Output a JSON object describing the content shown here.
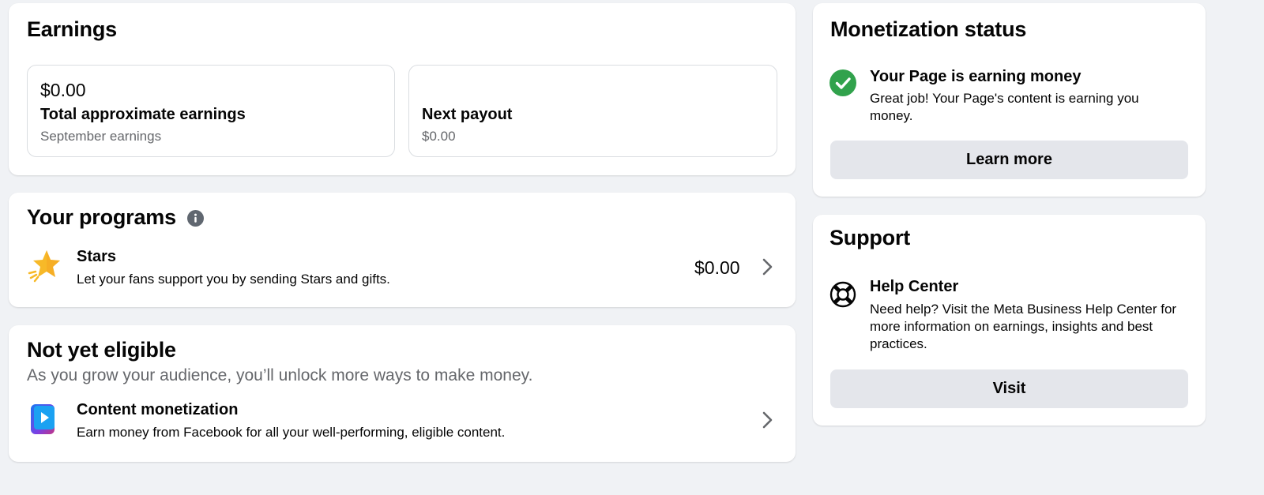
{
  "earnings": {
    "title": "Earnings",
    "total": {
      "amount": "$0.00",
      "label": "Total approximate earnings",
      "sub": "September earnings"
    },
    "payout": {
      "label": "Next payout",
      "sub": "$0.00"
    }
  },
  "programs": {
    "title": "Your programs",
    "items": [
      {
        "title": "Stars",
        "desc": "Let your fans support you by sending Stars and gifts.",
        "amount": "$0.00"
      }
    ]
  },
  "not_eligible": {
    "title": "Not yet eligible",
    "subtitle": "As you grow your audience, you’ll unlock more ways to make money.",
    "items": [
      {
        "title": "Content monetization",
        "desc": "Earn money from Facebook for all your well-performing, eligible content."
      }
    ]
  },
  "monetization": {
    "title": "Monetization status",
    "status_title": "Your Page is earning money",
    "status_desc_1": "Great job! Your Page's content is earning you",
    "status_desc_2": "money.",
    "button": "Learn more"
  },
  "support": {
    "title": "Support",
    "item_title": "Help Center",
    "item_desc_1": "Need help? Visit the Meta Business Help Center for",
    "item_desc_2": "more information on earnings, insights and best",
    "item_desc_3": "practices.",
    "button": "Visit"
  },
  "colors": {
    "accent_green": "#31a24c",
    "button_gray": "#e4e6eb",
    "secondary_text": "#65676b"
  }
}
